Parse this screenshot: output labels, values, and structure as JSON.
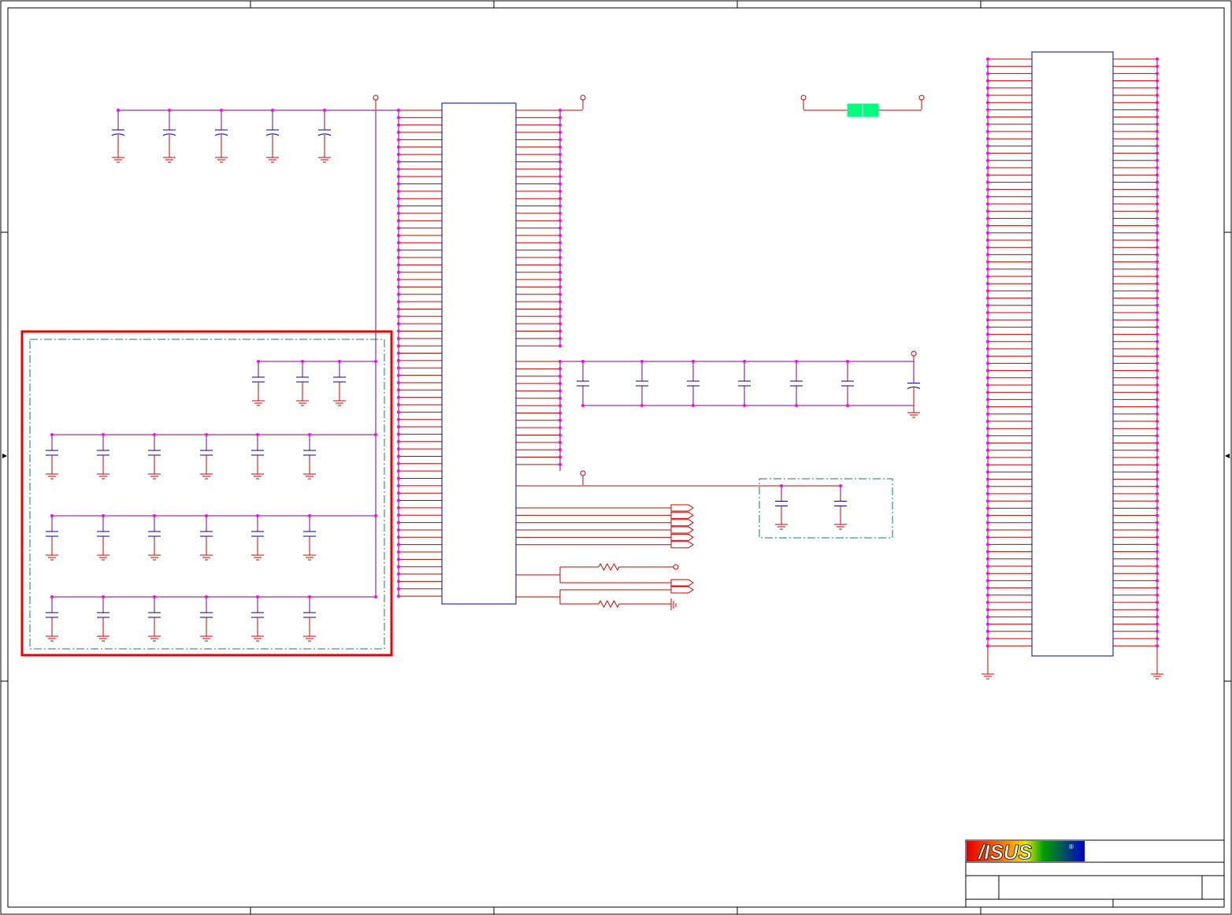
{
  "colors": {
    "background": "#ffffff",
    "wire_red": "#cc0000",
    "wire_purple": "#800080",
    "part_blue": "#000099",
    "junction_magenta": "#ff00ff",
    "highlight_red": "#ee0000",
    "group_teal": "#008080",
    "ferrite_green": "#00ff7f",
    "frame_black": "#000000"
  },
  "title_block": {
    "logo_text": "/ISUS",
    "logo_registered": "®"
  },
  "parts": {
    "connectors": [
      "left-edge-connector",
      "right-edge-connector"
    ],
    "icons": [
      "capacitor-icon",
      "resistor-icon",
      "ground-icon",
      "power-port-icon",
      "off-page-connector-icon",
      "ferrite-bead-icon",
      "ic-body-icon"
    ]
  }
}
